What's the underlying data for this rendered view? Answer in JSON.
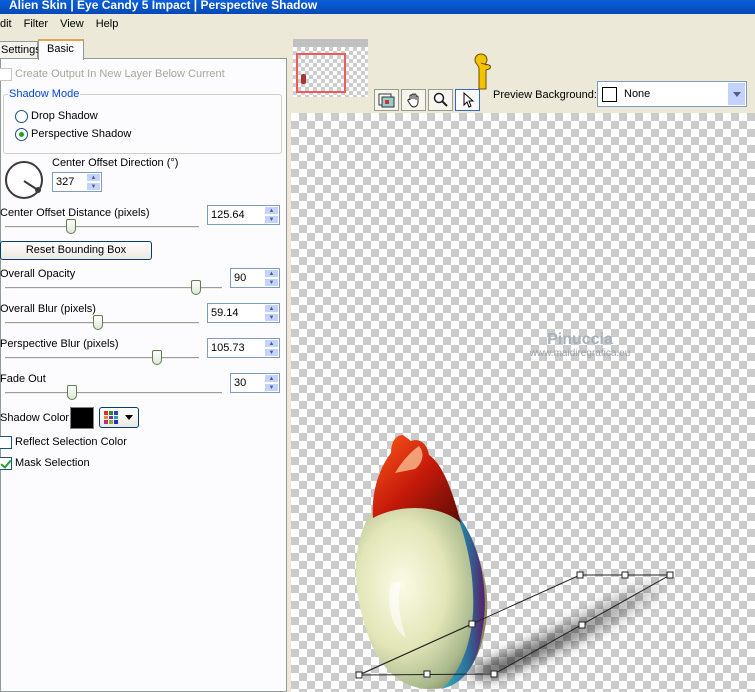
{
  "title": "Alien Skin | Eye Candy 5 Impact | Perspective Shadow",
  "menu": [
    "dit",
    "Filter",
    "View",
    "Help"
  ],
  "tabs": {
    "settings": "Settings",
    "basic": "Basic"
  },
  "basic": {
    "create_output_label": "Create Output In New Layer Below Current",
    "shadow_mode": {
      "legend": "Shadow Mode",
      "options": [
        "Drop Shadow",
        "Perspective Shadow"
      ],
      "selected": "Perspective Shadow"
    },
    "center_offset_direction": {
      "label": "Center Offset Direction (°)",
      "value": "327"
    },
    "center_offset_distance": {
      "label": "Center Offset Distance (pixels)",
      "value": "125.64",
      "fraction": 0.33
    },
    "reset_button": "Reset Bounding Box",
    "overall_opacity": {
      "label": "Overall Opacity",
      "value": "90",
      "fraction": 0.9
    },
    "overall_blur": {
      "label": "Overall Blur (pixels)",
      "value": "59.14",
      "fraction": 0.48
    },
    "perspective_blur": {
      "label": "Perspective Blur (pixels)",
      "value": "105.73",
      "fraction": 0.8
    },
    "fade_out": {
      "label": "Fade Out",
      "value": "30",
      "fraction": 0.3
    },
    "shadow_color": {
      "label": "Shadow Color",
      "color": "#000000"
    },
    "reflect_selection_label": "Reflect Selection Color",
    "mask_selection_label": "Mask Selection",
    "mask_selection_checked": true,
    "reflect_selection_checked": false
  },
  "preview": {
    "background_label": "Preview Background:",
    "background_value": "None",
    "watermark": {
      "line1": "Pinuccia",
      "line2": "www.maidiregrafica.eu"
    },
    "tools": [
      "preview-toggle-icon",
      "hand-icon",
      "magnifier-icon",
      "arrow-icon"
    ]
  },
  "colors": {
    "title_bar": "#0a5fd8",
    "accent_blue": "#0046d5",
    "check_green": "#21a121"
  }
}
